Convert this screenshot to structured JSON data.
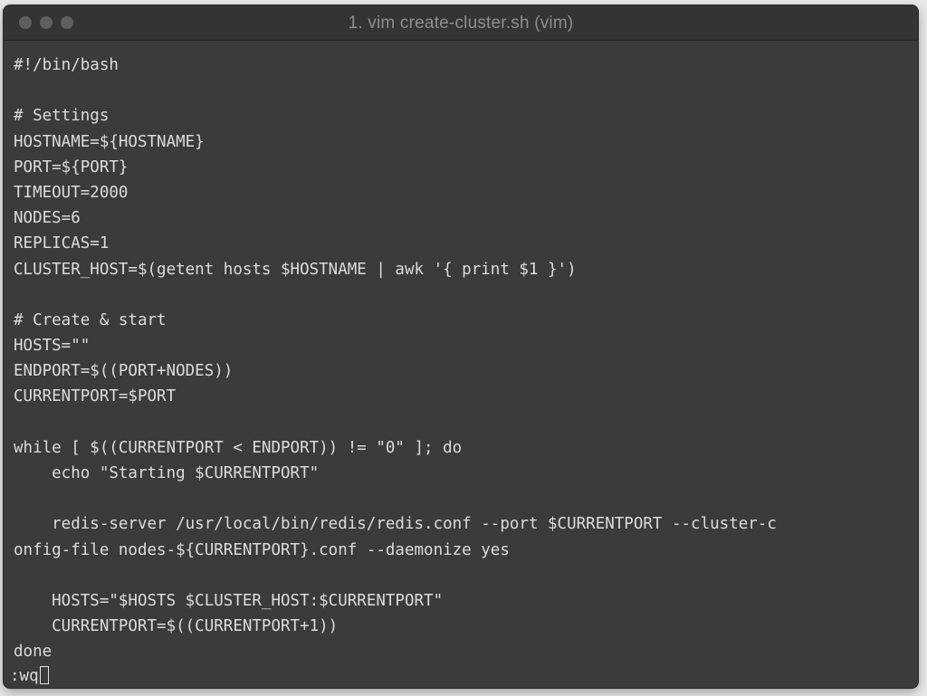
{
  "window": {
    "title": "1. vim create-cluster.sh (vim)"
  },
  "editor": {
    "lines": [
      "#!/bin/bash",
      "",
      "# Settings",
      "HOSTNAME=${HOSTNAME}",
      "PORT=${PORT}",
      "TIMEOUT=2000",
      "NODES=6",
      "REPLICAS=1",
      "CLUSTER_HOST=$(getent hosts $HOSTNAME | awk '{ print $1 }')",
      "",
      "# Create & start",
      "HOSTS=\"\"",
      "ENDPORT=$((PORT+NODES))",
      "CURRENTPORT=$PORT",
      "",
      "while [ $((CURRENTPORT < ENDPORT)) != \"0\" ]; do",
      "    echo \"Starting $CURRENTPORT\"",
      "",
      "    redis-server /usr/local/bin/redis/redis.conf --port $CURRENTPORT --cluster-c",
      "onfig-file nodes-${CURRENTPORT}.conf --daemonize yes",
      "",
      "    HOSTS=\"$HOSTS $CLUSTER_HOST:$CURRENTPORT\"",
      "    CURRENTPORT=$((CURRENTPORT+1))",
      "done"
    ]
  },
  "command_line": {
    "text": ":wq"
  },
  "colors": {
    "background": "#3b3b3b",
    "titlebar": "#343434",
    "text": "#dcdcdc",
    "title_text": "#8f8f8f",
    "traffic_lights": "#5f5f5f"
  },
  "icons": {
    "close": "close-button-icon",
    "minimize": "minimize-button-icon",
    "zoom": "zoom-button-icon",
    "cursor": "block-cursor"
  }
}
